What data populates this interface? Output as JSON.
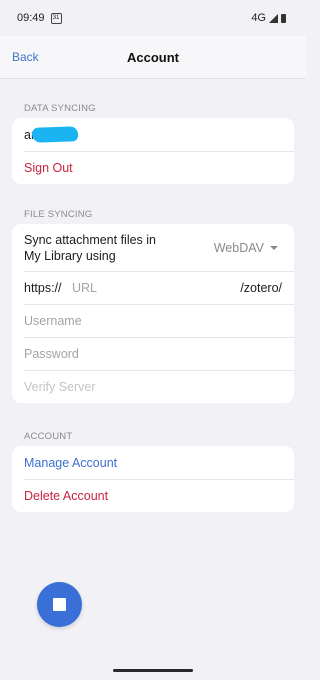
{
  "status_bar": {
    "time": "09:49",
    "calendar_badge": "31",
    "network": "4G"
  },
  "nav": {
    "back_label": "Back",
    "title": "Account"
  },
  "data_syncing": {
    "header": "DATA SYNCING",
    "username_visible": "ar",
    "sign_out_label": "Sign Out"
  },
  "file_syncing": {
    "header": "FILE SYNCING",
    "sync_label": "Sync attachment files in My Library using",
    "sync_value": "WebDAV",
    "url_prefix": "https://",
    "url_placeholder": "URL",
    "url_suffix": "/zotero/",
    "username_placeholder": "Username",
    "password_placeholder": "Password",
    "verify_label": "Verify Server"
  },
  "account": {
    "header": "ACCOUNT",
    "manage_label": "Manage Account",
    "delete_label": "Delete Account"
  },
  "colors": {
    "accent_blue": "#3b6fd0",
    "destructive_red": "#c8233e",
    "fab_blue": "#3a6fd8"
  },
  "icons": {
    "fab": "stop-icon"
  }
}
